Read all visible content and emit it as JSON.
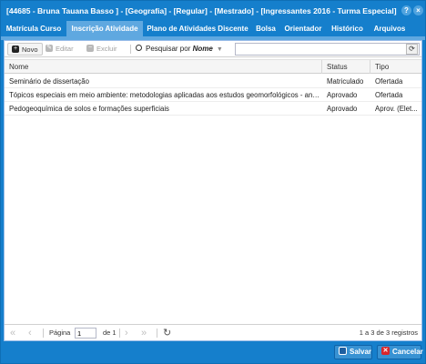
{
  "window": {
    "title": "[44685 - Bruna Tauana Basso ] - [Geografia] - [Regular] - [Mestrado] - [Ingressantes 2016 - Turma Especial]",
    "help_icon": "question-icon",
    "close_icon": "close-icon"
  },
  "tabs": [
    {
      "label": "Matrícula Curso",
      "active": false
    },
    {
      "label": "Inscrição Atividade",
      "active": true
    },
    {
      "label": "Plano de Atividades Discente",
      "active": false
    },
    {
      "label": "Bolsa",
      "active": false
    },
    {
      "label": "Orientador",
      "active": false
    },
    {
      "label": "Histórico",
      "active": false
    },
    {
      "label": "Arquivos",
      "active": false
    }
  ],
  "toolbar": {
    "novo_label": "Novo",
    "editar_label": "Editar",
    "excluir_label": "Excluir",
    "search_prefix": "Pesquisar por",
    "search_field": "Nome",
    "search_value": "",
    "refresh_icon": "refresh-icon"
  },
  "grid": {
    "columns": [
      "Nome",
      "Status",
      "Tipo"
    ],
    "rows": [
      {
        "nome": "Seminário de dissertação",
        "status": "Matriculado",
        "tipo": "Ofertada"
      },
      {
        "nome": "Tópicos especiais em meio ambiente: metodologias aplicadas aos estudos geomorfológicos - análi...",
        "status": "Aprovado",
        "tipo": "Ofertada"
      },
      {
        "nome": "Pedogeoquímica de solos e formações superficiais",
        "status": "Aprovado",
        "tipo": "Aprov. (Elet..."
      }
    ]
  },
  "pager": {
    "page_label": "Página",
    "page_value": "1",
    "of_label": "de 1",
    "info": "1 a 3 de 3 registros"
  },
  "footer": {
    "salvar_label": "Salvar",
    "cancelar_label": "Cancelar"
  },
  "colors": {
    "accent": "#157fcc",
    "active_tab": "#5fa8e0",
    "cancel_icon": "#d9262b"
  }
}
